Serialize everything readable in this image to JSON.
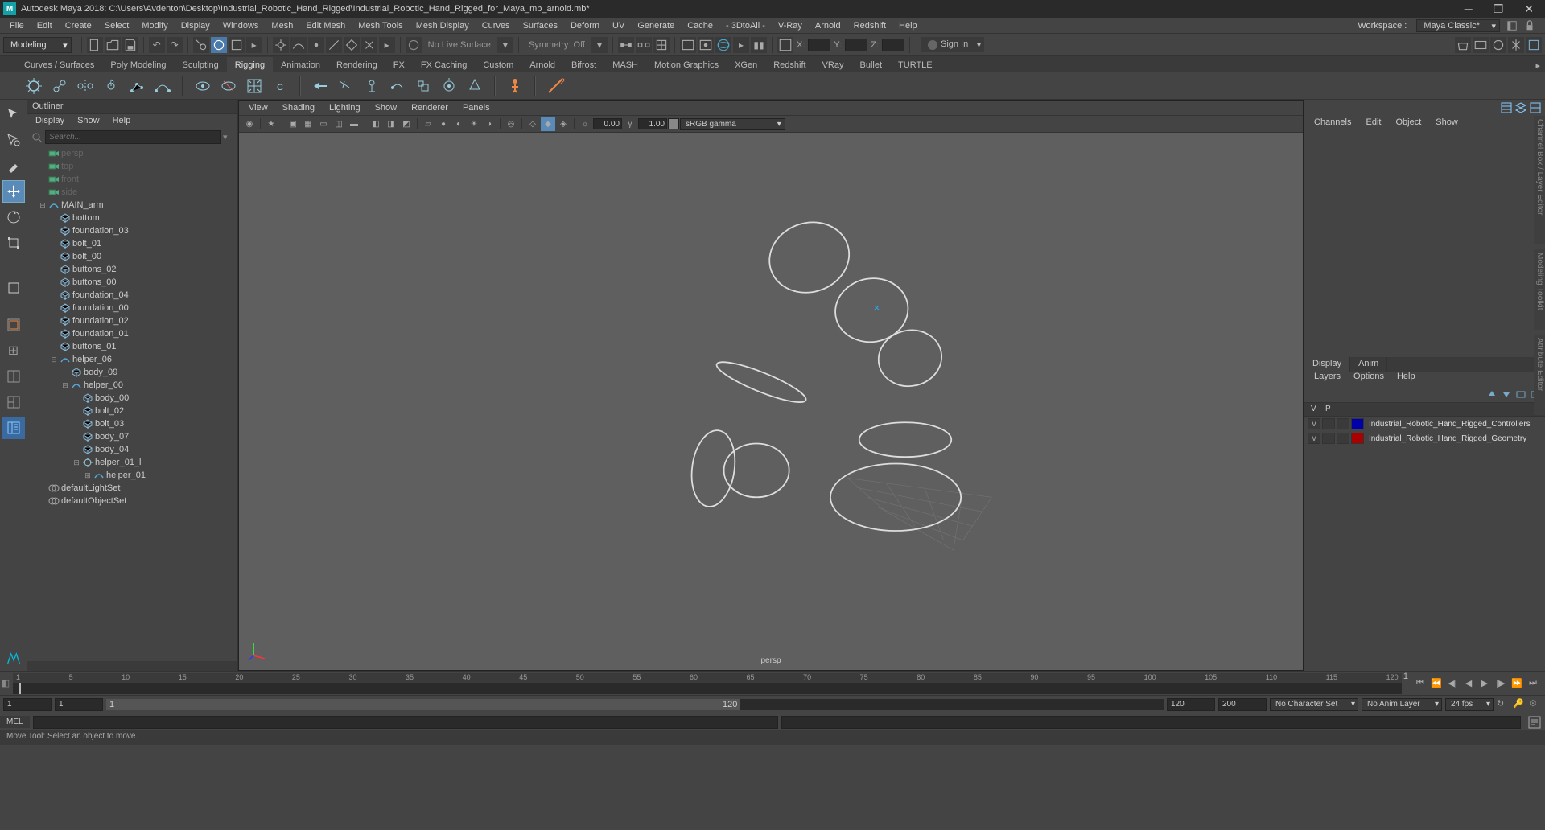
{
  "title": "Autodesk Maya 2018: C:\\Users\\Avdenton\\Desktop\\Industrial_Robotic_Hand_Rigged\\Industrial_Robotic_Hand_Rigged_for_Maya_mb_arnold.mb*",
  "menus": [
    "File",
    "Edit",
    "Create",
    "Select",
    "Modify",
    "Display",
    "Windows",
    "Mesh",
    "Edit Mesh",
    "Mesh Tools",
    "Mesh Display",
    "Curves",
    "Surfaces",
    "Deform",
    "UV",
    "Generate",
    "Cache",
    "- 3DtoAll -",
    "V-Ray",
    "Arnold",
    "Redshift",
    "Help"
  ],
  "workspace": {
    "label": "Workspace :",
    "value": "Maya Classic*"
  },
  "module": "Modeling",
  "statusline": {
    "live_surface": "No Live Surface",
    "symmetry": "Symmetry: Off",
    "coords": {
      "x": "X:",
      "y": "Y:",
      "z": "Z:"
    },
    "signin": "Sign In"
  },
  "shelf_tabs": [
    "Curves / Surfaces",
    "Poly Modeling",
    "Sculpting",
    "Rigging",
    "Animation",
    "Rendering",
    "FX",
    "FX Caching",
    "Custom",
    "Arnold",
    "Bifrost",
    "MASH",
    "Motion Graphics",
    "XGen",
    "Redshift",
    "VRay",
    "Bullet",
    "TURTLE"
  ],
  "shelf_active": "Rigging",
  "outliner": {
    "title": "Outliner",
    "menu": [
      "Display",
      "Show",
      "Help"
    ],
    "search_placeholder": "Search...",
    "items": [
      {
        "indent": 0,
        "icon": "camera",
        "label": "persp",
        "dim": true
      },
      {
        "indent": 0,
        "icon": "camera",
        "label": "top",
        "dim": true
      },
      {
        "indent": 0,
        "icon": "camera",
        "label": "front",
        "dim": true
      },
      {
        "indent": 0,
        "icon": "camera",
        "label": "side",
        "dim": true
      },
      {
        "indent": 0,
        "icon": "curve",
        "label": "MAIN_arm",
        "exp": "minus"
      },
      {
        "indent": 1,
        "icon": "mesh",
        "label": "bottom"
      },
      {
        "indent": 1,
        "icon": "mesh",
        "label": "foundation_03"
      },
      {
        "indent": 1,
        "icon": "mesh",
        "label": "bolt_01"
      },
      {
        "indent": 1,
        "icon": "mesh",
        "label": "bolt_00"
      },
      {
        "indent": 1,
        "icon": "mesh",
        "label": "buttons_02"
      },
      {
        "indent": 1,
        "icon": "mesh",
        "label": "buttons_00"
      },
      {
        "indent": 1,
        "icon": "mesh",
        "label": "foundation_04"
      },
      {
        "indent": 1,
        "icon": "mesh",
        "label": "foundation_00"
      },
      {
        "indent": 1,
        "icon": "mesh",
        "label": "foundation_02"
      },
      {
        "indent": 1,
        "icon": "mesh",
        "label": "foundation_01"
      },
      {
        "indent": 1,
        "icon": "mesh",
        "label": "buttons_01"
      },
      {
        "indent": 1,
        "icon": "curve",
        "label": "helper_06",
        "exp": "minus"
      },
      {
        "indent": 2,
        "icon": "mesh",
        "label": "body_09"
      },
      {
        "indent": 2,
        "icon": "curve",
        "label": "helper_00",
        "exp": "minus"
      },
      {
        "indent": 3,
        "icon": "mesh",
        "label": "body_00"
      },
      {
        "indent": 3,
        "icon": "mesh",
        "label": "bolt_02"
      },
      {
        "indent": 3,
        "icon": "mesh",
        "label": "bolt_03"
      },
      {
        "indent": 3,
        "icon": "mesh",
        "label": "body_07"
      },
      {
        "indent": 3,
        "icon": "mesh",
        "label": "body_04"
      },
      {
        "indent": 3,
        "icon": "joint",
        "label": "helper_01_l",
        "exp": "minus"
      },
      {
        "indent": 4,
        "icon": "curve",
        "label": "helper_01",
        "exp": "plus"
      },
      {
        "indent": 0,
        "icon": "set",
        "label": "defaultLightSet"
      },
      {
        "indent": 0,
        "icon": "set",
        "label": "defaultObjectSet"
      }
    ]
  },
  "viewport": {
    "menu": [
      "View",
      "Shading",
      "Lighting",
      "Show",
      "Renderer",
      "Panels"
    ],
    "exposure": "0.00",
    "gamma": "1.00",
    "renderer": "sRGB gamma",
    "camera": "persp"
  },
  "channelbox": {
    "tabs": [
      "Channels",
      "Edit",
      "Object",
      "Show"
    ],
    "layer_tabs": [
      "Display",
      "Anim"
    ],
    "layer_menu": [
      "Layers",
      "Options",
      "Help"
    ],
    "header": {
      "v": "V",
      "p": "P"
    },
    "layers": [
      {
        "color": "#0000aa",
        "name": "Industrial_Robotic_Hand_Rigged_Controllers"
      },
      {
        "color": "#aa0000",
        "name": "Industrial_Robotic_Hand_Rigged_Geometry"
      }
    ]
  },
  "timeslider": {
    "ticks": [
      "1",
      "5",
      "10",
      "15",
      "20",
      "25",
      "30",
      "35",
      "40",
      "45",
      "50",
      "55",
      "60",
      "65",
      "70",
      "75",
      "80",
      "85",
      "90",
      "95",
      "100",
      "105",
      "110",
      "115",
      "120"
    ],
    "end": "1"
  },
  "range": {
    "start_outer": "1",
    "start_inner": "1",
    "end_inner": "120",
    "end_outer": "200",
    "handle_start": "1",
    "handle_end": "120",
    "charset": "No Character Set",
    "animlayer": "No Anim Layer",
    "fps": "24 fps"
  },
  "cmdline": {
    "lang": "MEL"
  },
  "helpline": "Move Tool: Select an object to move."
}
